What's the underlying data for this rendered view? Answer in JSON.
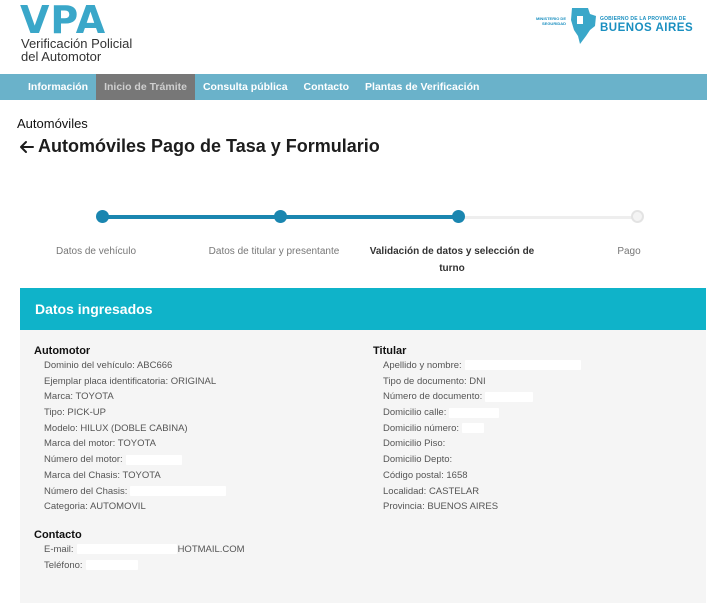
{
  "header": {
    "logo": "VPA",
    "logo_sub_1": "Verificación Policial",
    "logo_sub_2": "del Automotor",
    "gov_small_1": "MINISTERIO DE",
    "gov_small_2": "SEGURIDAD",
    "gov_line1": "GOBIERNO DE LA PROVINCIA DE",
    "gov_line2": "BUENOS AIRES"
  },
  "nav": {
    "items": [
      {
        "label": "Información"
      },
      {
        "label": "Inicio de Trámite"
      },
      {
        "label": "Consulta pública"
      },
      {
        "label": "Contacto"
      },
      {
        "label": "Plantas de Verificación"
      }
    ]
  },
  "page": {
    "breadcrumb": "Automóviles",
    "title": "Automóviles Pago de Tasa y Formulario"
  },
  "stepper": {
    "steps": [
      {
        "label": "Datos de vehículo"
      },
      {
        "label": "Datos de titular y presentante"
      },
      {
        "label": "Validación de datos y selección de turno"
      },
      {
        "label": "Pago"
      }
    ]
  },
  "card": {
    "title": "Datos ingresados",
    "automotor": {
      "title": "Automotor",
      "fields": [
        "Dominio del vehículo: ABC666",
        "Ejemplar placa identificatoria: ORIGINAL",
        "Marca: TOYOTA",
        "Tipo: PICK-UP",
        "Modelo: HILUX (DOBLE CABINA)",
        "Marca del motor: TOYOTA",
        "Número del motor:",
        "Marca del Chasis: TOYOTA",
        "Número del Chasis:",
        "Categoria: AUTOMOVIL"
      ]
    },
    "contacto": {
      "title": "Contacto",
      "email_label": "E-mail:",
      "email_domain": "HOTMAIL.COM",
      "phone_label": "Teléfono:"
    },
    "titular": {
      "title": "Titular",
      "fields": [
        "Apellido y nombre:",
        "Tipo de documento: DNI",
        "Número de documento:",
        "Domicilio calle:",
        "Domicilio número:",
        "Domicilio Piso:",
        "Domicilio Depto:",
        "Código postal: 1658",
        "Localidad: CASTELAR",
        "Provincia: BUENOS AIRES"
      ]
    }
  }
}
